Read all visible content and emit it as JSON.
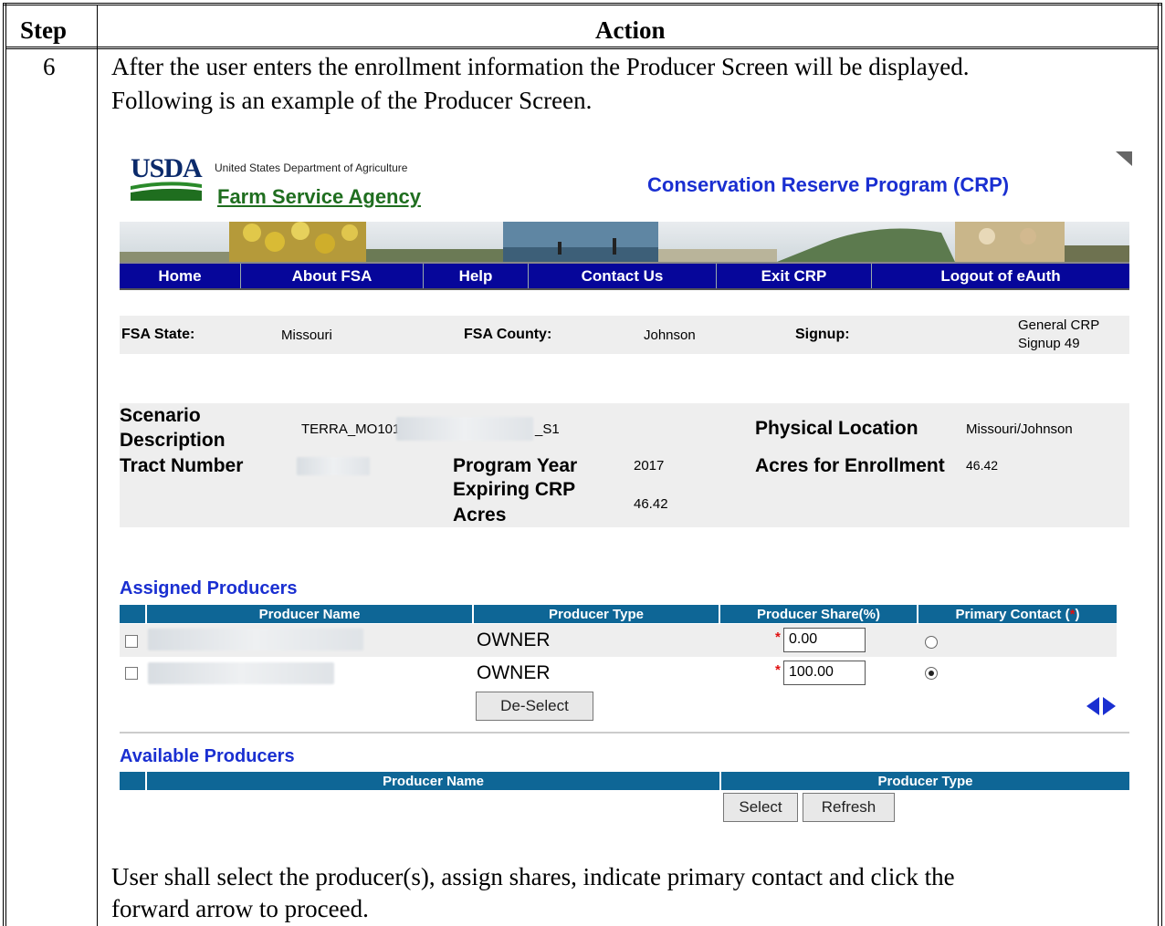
{
  "table": {
    "header_step": "Step",
    "header_action": "Action",
    "step_number": "6",
    "intro_line1": "After the user enters the enrollment information the Producer Screen will be displayed.",
    "intro_line2": "Following is an example of the Producer Screen.",
    "outro_line1": "User shall select the producer(s), assign shares, indicate primary contact and click the",
    "outro_line2": "forward arrow to proceed."
  },
  "screen": {
    "usda_word": "USDA",
    "department": "United States Department of Agriculture",
    "agency": "Farm Service Agency",
    "program_title": "Conservation Reserve Program (CRP)",
    "nav": [
      "Home",
      "About FSA",
      "Help",
      "Contact Us",
      "Exit CRP",
      "Logout of eAuth"
    ],
    "summary": {
      "state_label": "FSA State:",
      "state_value": "Missouri",
      "county_label": "FSA County:",
      "county_value": "Johnson",
      "signup_label": "Signup:",
      "signup_value_line1": "General CRP",
      "signup_value_line2": "Signup 49"
    },
    "details": {
      "scenario_label_line1": "Scenario",
      "scenario_label_line2": "Description",
      "scenario_value_prefix": "TERRA_MO101_",
      "scenario_value_suffix": "_S1",
      "physical_location_label": "Physical Location",
      "physical_location_value": "Missouri/Johnson",
      "tract_label": "Tract Number",
      "program_year_label": "Program Year",
      "program_year_value": "2017",
      "acres_enrollment_label": "Acres for Enrollment",
      "acres_enrollment_value": "46.42",
      "expiring_label_line1": "Expiring CRP",
      "expiring_label_line2": "Acres",
      "expiring_value": "46.42"
    },
    "assigned": {
      "title": "Assigned Producers",
      "columns": [
        "Producer Name",
        "Producer Type",
        "Producer Share(%)",
        "Primary Contact ("
      ],
      "required_mark": "*",
      "close_paren": ")",
      "rows": [
        {
          "type": "OWNER",
          "share": "0.00",
          "primary": false
        },
        {
          "type": "OWNER",
          "share": "100.00",
          "primary": true
        }
      ],
      "deselect_label": "De-Select"
    },
    "available": {
      "title": "Available Producers",
      "columns": [
        "Producer Name",
        "Producer Type"
      ],
      "select_label": "Select",
      "refresh_label": "Refresh"
    },
    "colors": {
      "nav_bg": "#06069a",
      "grid_header_bg": "#0e6696",
      "title_blue": "#1a2fd1",
      "agency_green": "#1f6e1f"
    }
  }
}
